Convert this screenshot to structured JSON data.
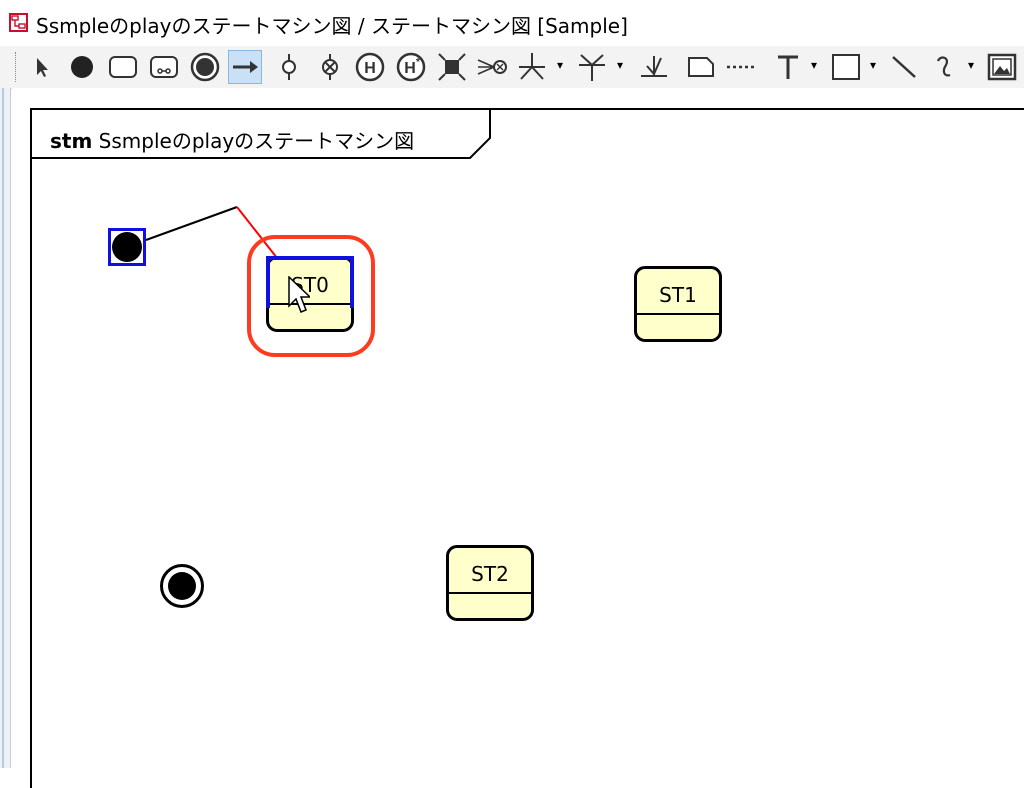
{
  "window": {
    "title": "Ssmpleのplayのステートマシン図 / ステートマシン図 [Sample]",
    "icon": "state-machine-diagram-icon"
  },
  "toolbar": {
    "tools": [
      {
        "name": "select-pointer-icon"
      },
      {
        "name": "initial-pseudostate-icon"
      },
      {
        "name": "state-icon"
      },
      {
        "name": "submachine-state-icon"
      },
      {
        "name": "final-state-icon"
      },
      {
        "name": "transition-arrow-icon",
        "active": true
      },
      {
        "name": "choice-icon"
      },
      {
        "name": "terminate-icon"
      },
      {
        "name": "shallow-history-icon",
        "label": "H"
      },
      {
        "name": "deep-history-icon",
        "label": "H*"
      },
      {
        "name": "fork-join-icon"
      },
      {
        "name": "entry-point-icon"
      },
      {
        "name": "junction-icon"
      },
      {
        "name": "merge-icon"
      },
      {
        "name": "anchor-icon"
      },
      {
        "name": "note-icon"
      },
      {
        "name": "note-anchor-icon"
      },
      {
        "name": "text-icon",
        "label": "T"
      },
      {
        "name": "rectangle-icon"
      },
      {
        "name": "line-icon"
      },
      {
        "name": "freehand-icon"
      },
      {
        "name": "image-icon"
      }
    ]
  },
  "diagram": {
    "frame_keyword": "stm",
    "frame_name": "Ssmpleのplayのステートマシン図",
    "states": [
      {
        "id": "st0",
        "name": "ST0",
        "selected": true
      },
      {
        "id": "st1",
        "name": "ST1"
      },
      {
        "id": "st2",
        "name": "ST2"
      }
    ],
    "highlight_color": "#ff3b1f",
    "selection_color": "#1010e0",
    "state_fill": "#ffffcc",
    "transition_color": "#ff0000"
  }
}
